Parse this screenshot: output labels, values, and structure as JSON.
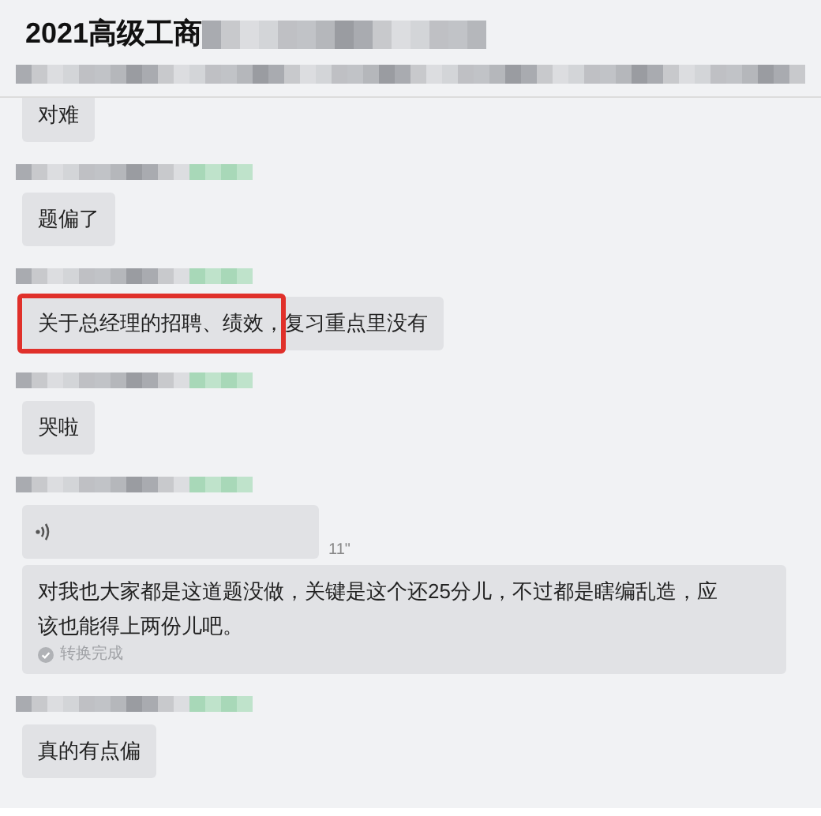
{
  "header": {
    "title": "2021高级工商"
  },
  "messages": [
    {
      "kind": "text",
      "text": "对难",
      "highlighted": false,
      "sender_shown": false
    },
    {
      "kind": "text",
      "text": "题偏了",
      "highlighted": false,
      "sender_shown": true
    },
    {
      "kind": "text",
      "text": "关于总经理的招聘、绩效，复习重点里没有",
      "highlighted": true,
      "sender_shown": true
    },
    {
      "kind": "text",
      "text": "哭啦",
      "highlighted": false,
      "sender_shown": true
    },
    {
      "kind": "voice",
      "duration": "11\"",
      "transcript": "对我也大家都是这道题没做，关键是这个还25分儿，不过都是瞎编乱造，应该也能得上两份儿吧。",
      "status": "转换完成",
      "highlighted": false,
      "sender_shown": true
    },
    {
      "kind": "text",
      "text": "真的有点偏",
      "highlighted": false,
      "sender_shown": true
    }
  ]
}
